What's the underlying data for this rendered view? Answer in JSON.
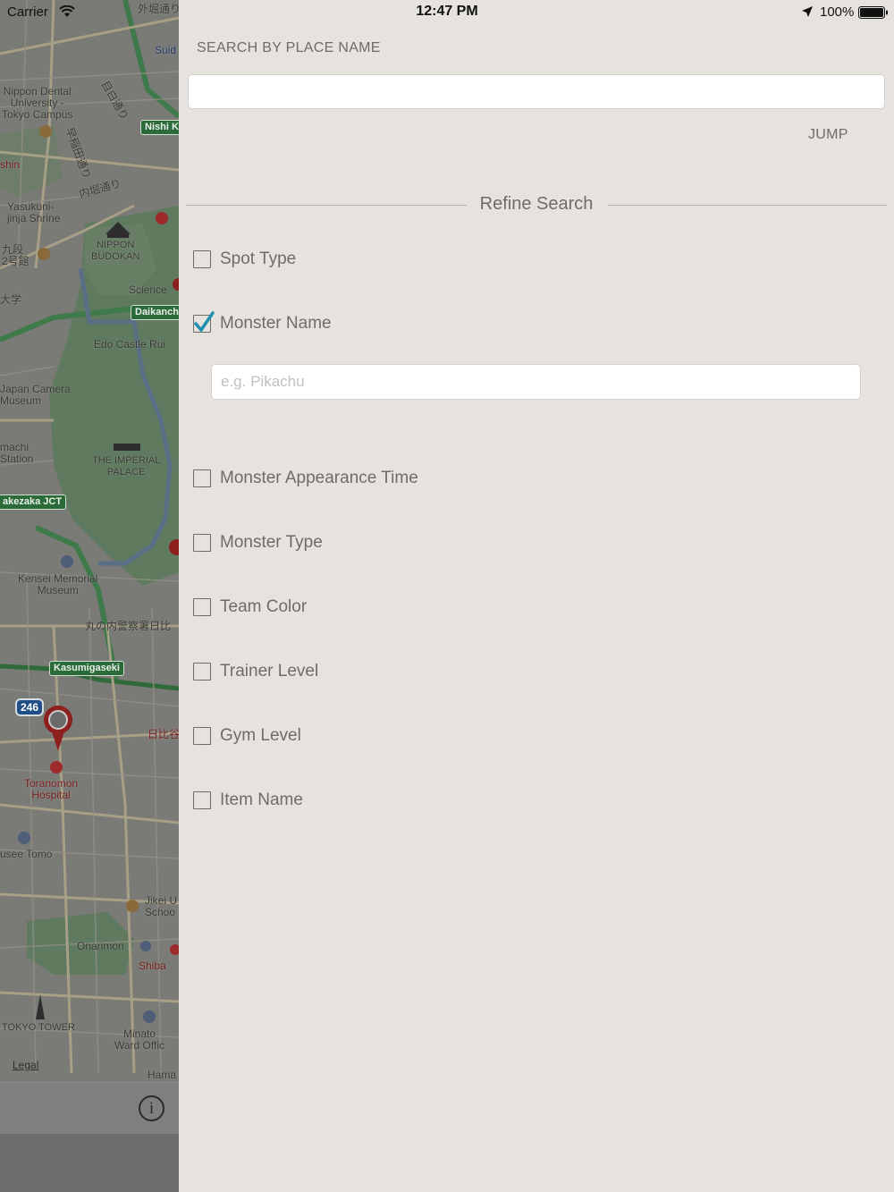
{
  "status_bar": {
    "carrier": "Carrier",
    "time": "12:47 PM",
    "battery": "100%"
  },
  "map": {
    "labels": {
      "sotobori": "外堀通り",
      "suido": "Suid",
      "nippon_dental": "Nippon Dental\nUniversity -\nTokyo Campus",
      "mejiro": "目白通り",
      "waseda": "早稲田通り",
      "uchibori": "内堀通り",
      "shin": "shin",
      "yasukuni": "Yasukuni-\njinja Shrine",
      "kudan": "九段\n2号館",
      "budokan": "NIPPON\nBUDOKAN",
      "science": "Science",
      "daigaku": "大学",
      "edo_castle": "Edo Castle Rui",
      "camera_museum": "Japan Camera\nMuseum",
      "station": "machi\nStation",
      "imperial_palace": "THE IMPERIAL\nPALACE",
      "kensei": "Kensei Memorial\nMuseum",
      "marunouchi_police": "丸の内警察署日比",
      "hibiya": "日比谷",
      "toranomon": "Toranomon\nHospital",
      "usee": "usee Tomo",
      "jikei": "Jikei U\nSchoo",
      "onarimon": "Onarimon",
      "shiba": "Shiba",
      "tokyo_tower": "TOKYO TOWER",
      "minato": "Minato\nWard Offic",
      "hama": "Hama"
    },
    "road_signs": {
      "nishi_ka": "Nishi Ka",
      "daikancho": "Daikancho",
      "takezaka": "akezaka JCT",
      "kasumigaseki": "Kasumigaseki",
      "route_246": "246"
    },
    "legal": "Legal",
    "info_glyph": "i"
  },
  "panel": {
    "search_label": "SEARCH BY PLACE NAME",
    "place_input": {
      "value": "",
      "placeholder": ""
    },
    "jump_label": "JUMP",
    "refine_title": "Refine Search",
    "options": [
      {
        "label": "Spot Type",
        "checked": false
      },
      {
        "label": "Monster Name",
        "checked": true
      },
      {
        "label": "Monster Appearance Time",
        "checked": false
      },
      {
        "label": "Monster Type",
        "checked": false
      },
      {
        "label": "Team Color",
        "checked": false
      },
      {
        "label": "Trainer Level",
        "checked": false
      },
      {
        "label": "Gym Level",
        "checked": false
      },
      {
        "label": "Item Name",
        "checked": false
      }
    ],
    "monster_name_input": {
      "value": "",
      "placeholder": "e.g. Pikachu"
    }
  },
  "colors": {
    "panel_bg": "#e6e3de",
    "text_muted": "#6f6c68",
    "checkmark": "#1f8fae",
    "map_dim": "#7a7a76"
  }
}
